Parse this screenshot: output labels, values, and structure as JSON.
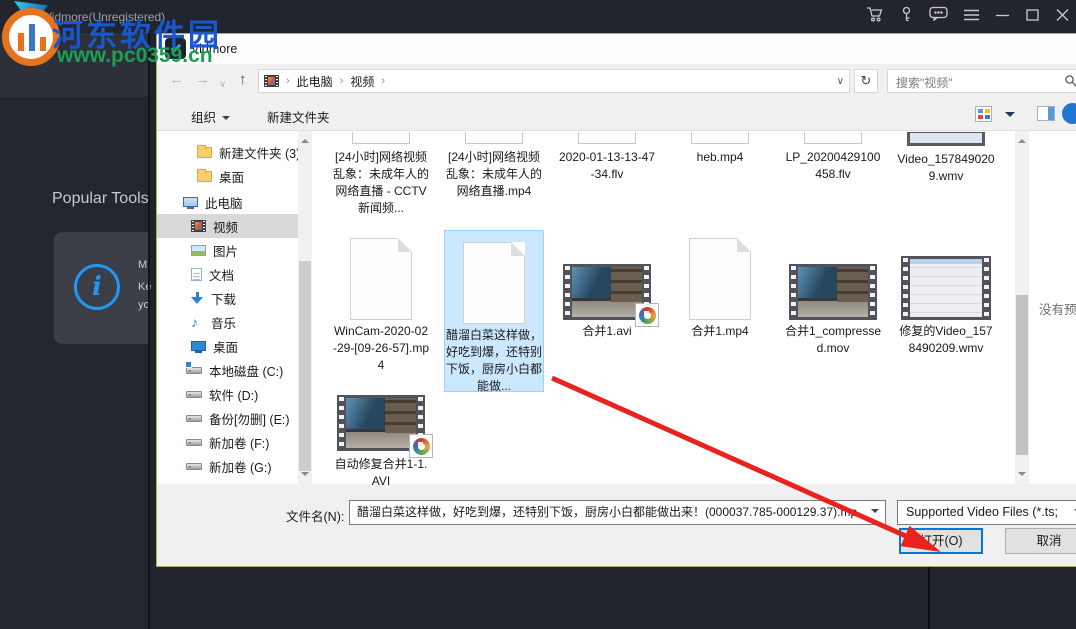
{
  "watermark": {
    "site_name": "河东软件园",
    "site_url": "www.pc0359.cn"
  },
  "app": {
    "title": "Vidmore(Unregistered)",
    "popular_tools_label": "Popular Tools",
    "card_text_fragments": {
      "line1": "M",
      "line2": "Ke",
      "line3": "yo"
    }
  },
  "dialog": {
    "title": "Vidmore",
    "address": {
      "crumb1": "此电脑",
      "crumb2": "视频"
    },
    "search": {
      "placeholder": "搜索\"视频\""
    },
    "toolbar": {
      "organize_label": "组织",
      "new_folder_label": "新建文件夹"
    },
    "sidebar": {
      "items": [
        {
          "label": "新建文件夹 (3)",
          "icon": "folder"
        },
        {
          "label": "桌面",
          "icon": "folder"
        },
        {
          "label": "此电脑",
          "icon": "pc"
        },
        {
          "label": "视频",
          "icon": "video",
          "selected": true
        },
        {
          "label": "图片",
          "icon": "picture"
        },
        {
          "label": "文档",
          "icon": "document"
        },
        {
          "label": "下载",
          "icon": "download"
        },
        {
          "label": "音乐",
          "icon": "music"
        },
        {
          "label": "桌面",
          "icon": "desktop"
        },
        {
          "label": "本地磁盘 (C:)",
          "icon": "drive-windows"
        },
        {
          "label": "软件 (D:)",
          "icon": "drive"
        },
        {
          "label": "备份[勿删] (E:)",
          "icon": "drive"
        },
        {
          "label": "新加卷 (F:)",
          "icon": "drive"
        },
        {
          "label": "新加卷 (G:)",
          "icon": "drive"
        }
      ]
    },
    "files": {
      "row1": [
        {
          "name": "[24小时]网络视频乱象：未成年人的网络直播 - CCTV 新闻频...",
          "thumb": "doc-sliver"
        },
        {
          "name": "[24小时]网络视频乱象：未成年人的网络直播.mp4",
          "thumb": "doc-sliver"
        },
        {
          "name": "2020-01-13-13-47-34.flv",
          "thumb": "doc-sliver"
        },
        {
          "name": "heb.mp4",
          "thumb": "doc-sliver"
        },
        {
          "name": "LP_20200429100458.flv",
          "thumb": "doc-sliver"
        },
        {
          "name": "Video_1578490209.wmv",
          "thumb": "film-sliver"
        }
      ],
      "row2": [
        {
          "name": "WinCam-2020-02-29-[09-26-57].mp4",
          "thumb": "document"
        },
        {
          "name": "醋溜白菜这样做，好吃到爆，还特别下饭，厨房小白都能做...",
          "thumb": "document",
          "selected": true
        },
        {
          "name": "合并1.avi",
          "thumb": "filmstrip-dark",
          "overlay_icon": true
        },
        {
          "name": "合并1.mp4",
          "thumb": "document"
        },
        {
          "name": "合并1_compressed.mov",
          "thumb": "filmstrip-dark"
        },
        {
          "name": "修复的Video_1578490209.wmv",
          "thumb": "filmstrip-light"
        }
      ],
      "row3": [
        {
          "name": "自动修复合并1-1.AVI",
          "thumb": "filmstrip-dark",
          "overlay_icon": true
        }
      ]
    },
    "preview_pane": {
      "empty_text": "没有预览"
    },
    "footer": {
      "filename_label": "文件名(N):",
      "filename_value": "醋溜白菜这样做，好吃到爆，还特别下饭，厨房小白都能做出来！(000037.785-000129.37).mp",
      "filetype_value": "Supported Video Files (*.ts;",
      "open_label": "打开(O)",
      "cancel_label": "取消"
    }
  },
  "colors": {
    "accent_blue": "#0078d7",
    "selection_bg": "#cce8ff",
    "selection_border": "#99d1ff",
    "arrow_red": "#e8231d",
    "dialog_border": "#a2af5e",
    "watermark_blue": "#1757d0",
    "watermark_green": "#1d9e53",
    "info_icon_blue": "#2196f3"
  }
}
